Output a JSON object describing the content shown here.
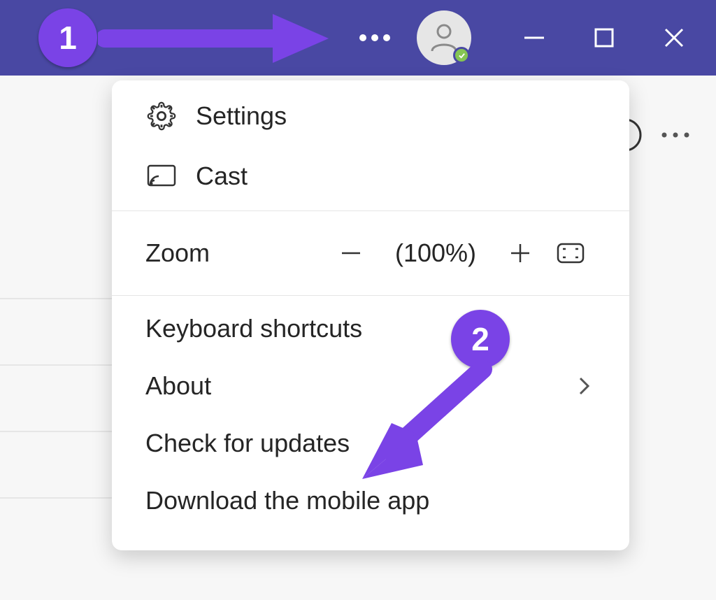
{
  "titlebar": {
    "icons": {
      "more": "more-icon",
      "avatar": "user-avatar",
      "presence": "available",
      "minimize": "minimize-icon",
      "maximize": "maximize-icon",
      "close": "close-icon"
    }
  },
  "menu": {
    "settings_label": "Settings",
    "cast_label": "Cast",
    "zoom_label": "Zoom",
    "zoom_value": "(100%)",
    "shortcuts_label": "Keyboard shortcuts",
    "about_label": "About",
    "updates_label": "Check for updates",
    "mobile_label": "Download the mobile app"
  },
  "annotations": {
    "badge1": "1",
    "badge2": "2"
  }
}
